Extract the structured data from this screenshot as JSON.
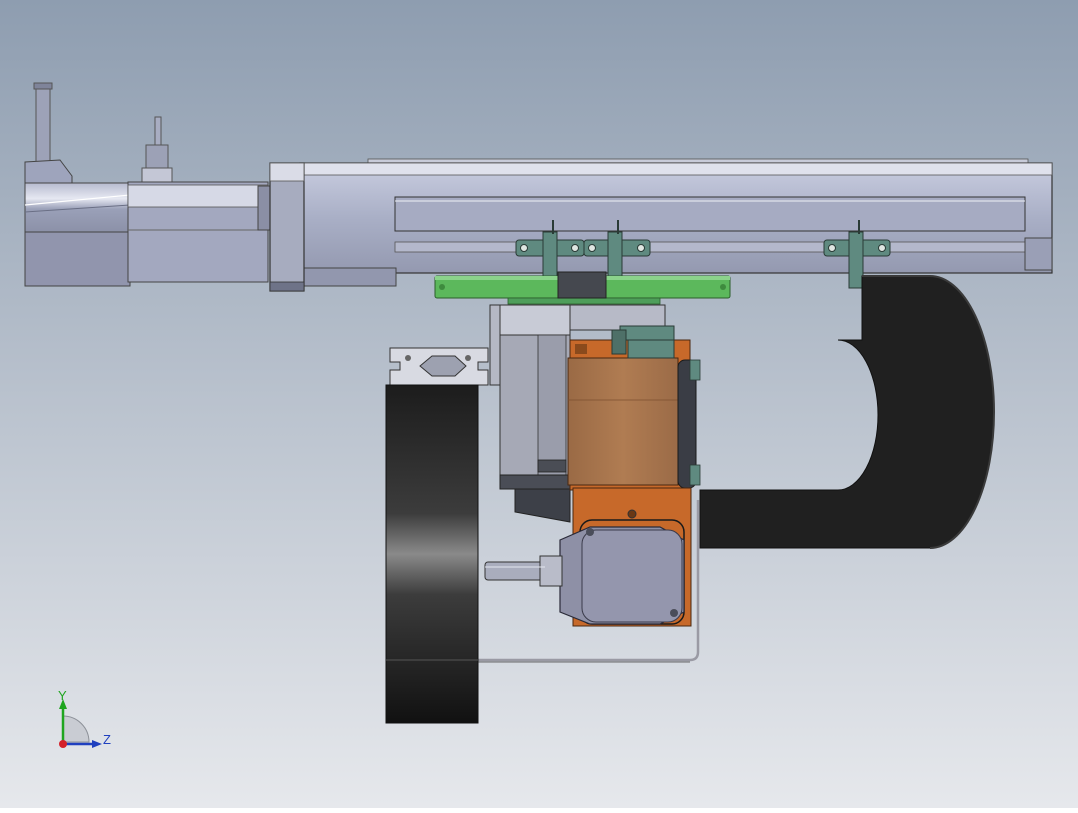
{
  "viewport": {
    "background_top": "#8e9db0",
    "background_bottom": "#e6e8ec"
  },
  "triad": {
    "y_label": "Y",
    "z_label": "Z",
    "y_color": "#1fa51f",
    "z_color": "#1f3fbf",
    "origin_color": "#d4202a"
  },
  "colors": {
    "rail_body": "#aab0c6",
    "motor": "#9ea4bc",
    "slider_plate": "#5cb85c",
    "bracket": "#5f8a80",
    "copper_block": "#a8744d",
    "copper_plate": "#c7692a",
    "gear_housing": "#8e90a6",
    "cable_chain": "#202020",
    "wheel": "#2a2a2a"
  }
}
